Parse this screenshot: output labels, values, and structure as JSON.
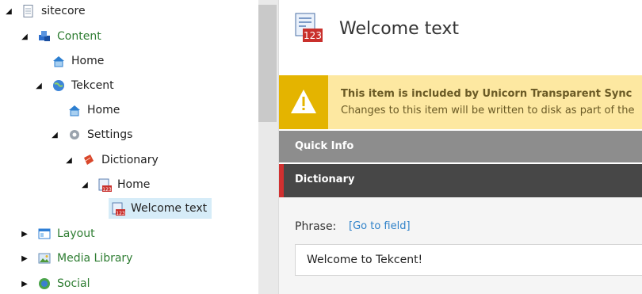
{
  "tree": {
    "items": [
      {
        "label": "sitecore"
      },
      {
        "label": "Content"
      },
      {
        "label": "Home"
      },
      {
        "label": "Tekcent"
      },
      {
        "label": "Home"
      },
      {
        "label": "Settings"
      },
      {
        "label": "Dictionary"
      },
      {
        "label": "Home"
      },
      {
        "label": "Welcome text"
      },
      {
        "label": "Layout"
      },
      {
        "label": "Media Library"
      },
      {
        "label": "Social"
      }
    ]
  },
  "editor": {
    "title": "Welcome text",
    "warning": {
      "title": "This item is included by Unicorn Transparent Sync",
      "text": "Changes to this item will be written to disk as part of the"
    },
    "sections": {
      "quick_info": "Quick Info",
      "dictionary": "Dictionary"
    },
    "field": {
      "label": "Phrase:",
      "link": "[Go to field]",
      "value": "Welcome to Tekcent!"
    }
  }
}
